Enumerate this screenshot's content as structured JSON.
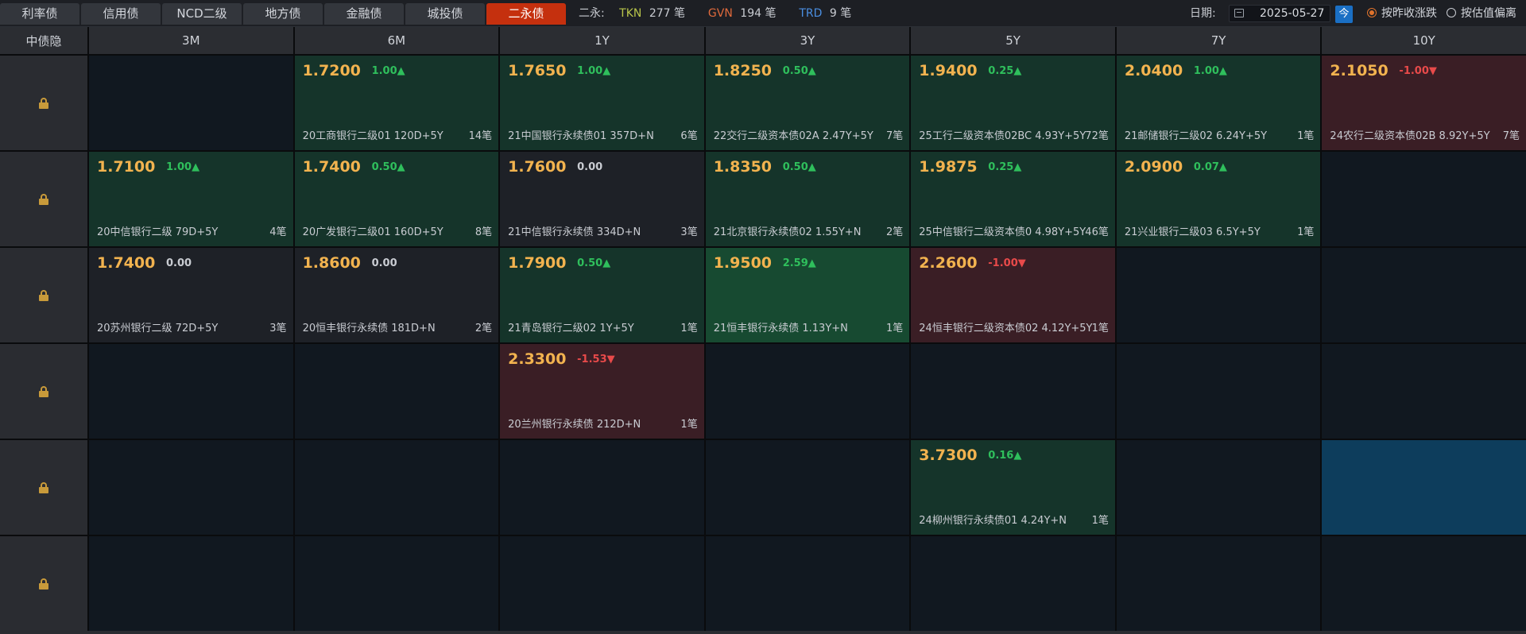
{
  "tabs": [
    "利率债",
    "信用债",
    "NCD二级",
    "地方债",
    "金融债",
    "城投债",
    "二永债"
  ],
  "active_tab_index": 6,
  "summary": {
    "label": "二永:",
    "tkn_label": "TKN",
    "tkn_count": "277 笔",
    "gvn_label": "GVN",
    "gvn_count": "194 笔",
    "trd_label": "TRD",
    "trd_count": "9 笔"
  },
  "date": {
    "label": "日期:",
    "value": "2025-05-27",
    "today_label": "今"
  },
  "radios": [
    {
      "label": "按昨收涨跌",
      "checked": true
    },
    {
      "label": "按估值偏离",
      "checked": false
    }
  ],
  "grid": {
    "corner": "中债隐",
    "columns": [
      "3M",
      "6M",
      "1Y",
      "3Y",
      "5Y",
      "7Y",
      "10Y"
    ],
    "rows": [
      [
        {
          "empty": true
        },
        {
          "yield": "1.7200",
          "change": "1.00▲",
          "dir": "up",
          "bond": "20工商银行二级01 120D+5Y",
          "count": "14笔"
        },
        {
          "yield": "1.7650",
          "change": "1.00▲",
          "dir": "up",
          "bond": "21中国银行永续债01 357D+N",
          "count": "6笔"
        },
        {
          "yield": "1.8250",
          "change": "0.50▲",
          "dir": "up",
          "bond": "22交行二级资本债02A 2.47Y+5Y",
          "count": "7笔"
        },
        {
          "yield": "1.9400",
          "change": "0.25▲",
          "dir": "up",
          "bond": "25工行二级资本债02BC 4.93Y+5Y",
          "count": "72笔"
        },
        {
          "yield": "2.0400",
          "change": "1.00▲",
          "dir": "up",
          "bond": "21邮储银行二级02 6.24Y+5Y",
          "count": "1笔"
        },
        {
          "yield": "2.1050",
          "change": "-1.00▼",
          "dir": "down",
          "bond": "24农行二级资本债02B 8.92Y+5Y",
          "count": "7笔"
        }
      ],
      [
        {
          "yield": "1.7100",
          "change": "1.00▲",
          "dir": "up",
          "bond": "20中信银行二级 79D+5Y",
          "count": "4笔"
        },
        {
          "yield": "1.7400",
          "change": "0.50▲",
          "dir": "up",
          "bond": "20广发银行二级01 160D+5Y",
          "count": "8笔"
        },
        {
          "yield": "1.7600",
          "change": "0.00",
          "dir": "flat",
          "bond": "21中信银行永续债 334D+N",
          "count": "3笔"
        },
        {
          "yield": "1.8350",
          "change": "0.50▲",
          "dir": "up",
          "bond": "21北京银行永续债02 1.55Y+N",
          "count": "2笔"
        },
        {
          "yield": "1.9875",
          "change": "0.25▲",
          "dir": "up",
          "bond": "25中信银行二级资本债0 4.98Y+5Y",
          "count": "46笔"
        },
        {
          "yield": "2.0900",
          "change": "0.07▲",
          "dir": "up",
          "bond": "21兴业银行二级03 6.5Y+5Y",
          "count": "1笔"
        },
        {
          "empty": true
        }
      ],
      [
        {
          "yield": "1.7400",
          "change": "0.00",
          "dir": "flat",
          "bond": "20苏州银行二级 72D+5Y",
          "count": "3笔"
        },
        {
          "yield": "1.8600",
          "change": "0.00",
          "dir": "flat",
          "bond": "20恒丰银行永续债 181D+N",
          "count": "2笔"
        },
        {
          "yield": "1.7900",
          "change": "0.50▲",
          "dir": "up",
          "bond": "21青岛银行二级02 1Y+5Y",
          "count": "1笔"
        },
        {
          "yield": "1.9500",
          "change": "2.59▲",
          "dir": "up2",
          "bond": "21恒丰银行永续债 1.13Y+N",
          "count": "1笔"
        },
        {
          "yield": "2.2600",
          "change": "-1.00▼",
          "dir": "down",
          "bond": "24恒丰银行二级资本债02 4.12Y+5Y",
          "count": "1笔"
        },
        {
          "empty": true
        },
        {
          "empty": true
        }
      ],
      [
        {
          "empty": true
        },
        {
          "empty": true
        },
        {
          "yield": "2.3300",
          "change": "-1.53▼",
          "dir": "down",
          "bond": "20兰州银行永续债 212D+N",
          "count": "1笔"
        },
        {
          "empty": true
        },
        {
          "empty": true
        },
        {
          "empty": true
        },
        {
          "empty": true
        }
      ],
      [
        {
          "empty": true
        },
        {
          "empty": true
        },
        {
          "empty": true
        },
        {
          "empty": true
        },
        {
          "yield": "3.7300",
          "change": "0.16▲",
          "dir": "up",
          "bond": "24柳州银行永续债01 4.24Y+N",
          "count": "1笔"
        },
        {
          "empty": true
        },
        {
          "empty": true,
          "selected": true
        }
      ],
      [
        {
          "empty": true
        },
        {
          "empty": true
        },
        {
          "empty": true
        },
        {
          "empty": true
        },
        {
          "empty": true
        },
        {
          "empty": true
        },
        {
          "empty": true
        }
      ]
    ]
  },
  "colors": {
    "accent_tab": "#c5300e",
    "yield_text": "#f2b34f",
    "up": "#2fbf5c",
    "down": "#e84a4a",
    "lock": "#c89a3a"
  }
}
